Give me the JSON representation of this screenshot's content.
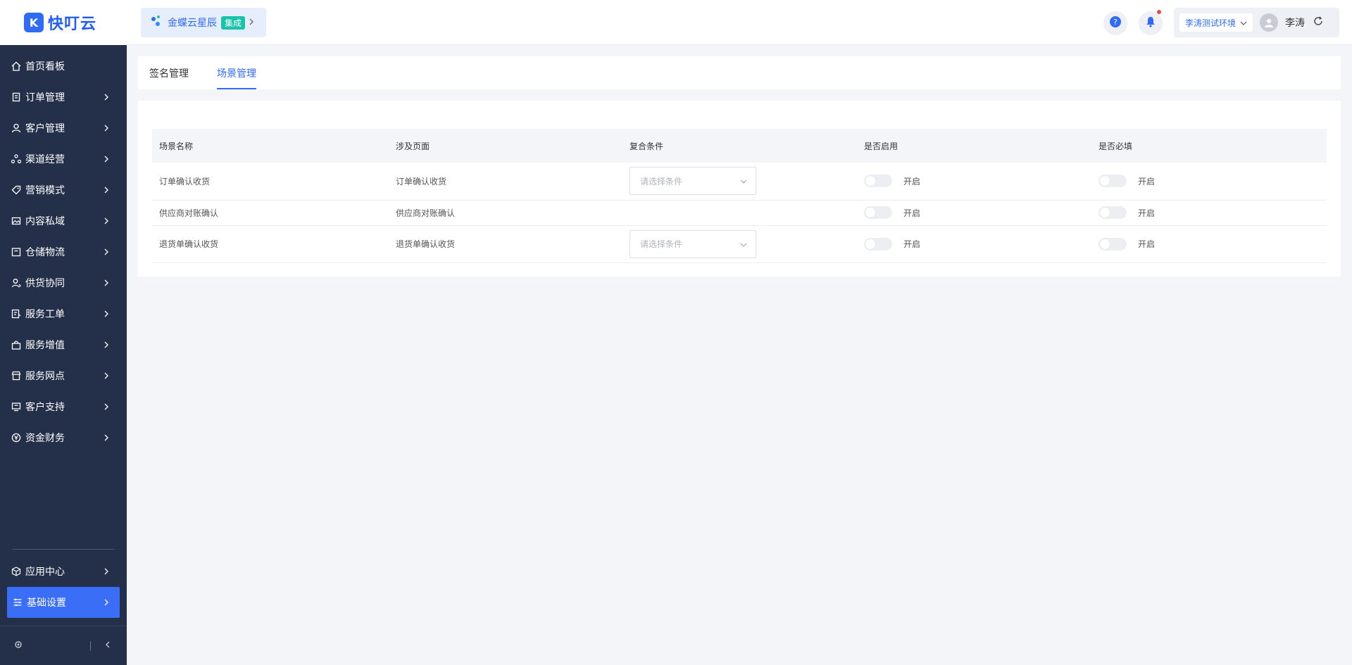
{
  "brand": {
    "logo_letter": "K",
    "name": "快叮云"
  },
  "sidebar": {
    "items": [
      {
        "label": "首页看板",
        "icon": "home-icon",
        "has_children": false
      },
      {
        "label": "订单管理",
        "icon": "clipboard-icon",
        "has_children": true
      },
      {
        "label": "客户管理",
        "icon": "user-icon",
        "has_children": true
      },
      {
        "label": "渠道经营",
        "icon": "channel-icon",
        "has_children": true
      },
      {
        "label": "营销模式",
        "icon": "tag-icon",
        "has_children": true
      },
      {
        "label": "内容私域",
        "icon": "image-icon",
        "has_children": true
      },
      {
        "label": "仓储物流",
        "icon": "box-icon",
        "has_children": true
      },
      {
        "label": "供货协同",
        "icon": "user-sync-icon",
        "has_children": true
      },
      {
        "label": "服务工单",
        "icon": "ticket-icon",
        "has_children": true
      },
      {
        "label": "服务增值",
        "icon": "bag-icon",
        "has_children": true
      },
      {
        "label": "服务网点",
        "icon": "store-icon",
        "has_children": true
      },
      {
        "label": "客户支持",
        "icon": "support-icon",
        "has_children": true
      },
      {
        "label": "资金财务",
        "icon": "yen-icon",
        "has_children": true
      }
    ],
    "bottom_items": [
      {
        "label": "应用中心",
        "icon": "cube-icon",
        "active": false
      },
      {
        "label": "基础设置",
        "icon": "settings-list-icon",
        "active": true
      }
    ]
  },
  "header": {
    "org_name": "金蝶云星辰",
    "org_badge": "集成",
    "environment": "李涛测试环境",
    "user_name": "李涛"
  },
  "tabs": [
    {
      "label": "签名管理",
      "active": false
    },
    {
      "label": "场景管理",
      "active": true
    }
  ],
  "table": {
    "columns": [
      "场景名称",
      "涉及页面",
      "复合条件",
      "是否启用",
      "是否必填"
    ],
    "rows": [
      {
        "name": "订单确认收货",
        "page": "订单确认收货",
        "condition_placeholder": "请选择条件",
        "enabled_label": "开启",
        "required_label": "开启"
      },
      {
        "name": "供应商对账确认",
        "page": "供应商对账确认",
        "condition_placeholder": null,
        "enabled_label": "开启",
        "required_label": "开启"
      },
      {
        "name": "退货单确认收货",
        "page": "退货单确认收货",
        "condition_placeholder": "请选择条件",
        "enabled_label": "开启",
        "required_label": "开启"
      }
    ]
  },
  "colors": {
    "primary": "#2f6bf5",
    "sidebar_bg": "#243049",
    "badge": "#18c3a9",
    "notify_dot": "#f04b3c"
  }
}
